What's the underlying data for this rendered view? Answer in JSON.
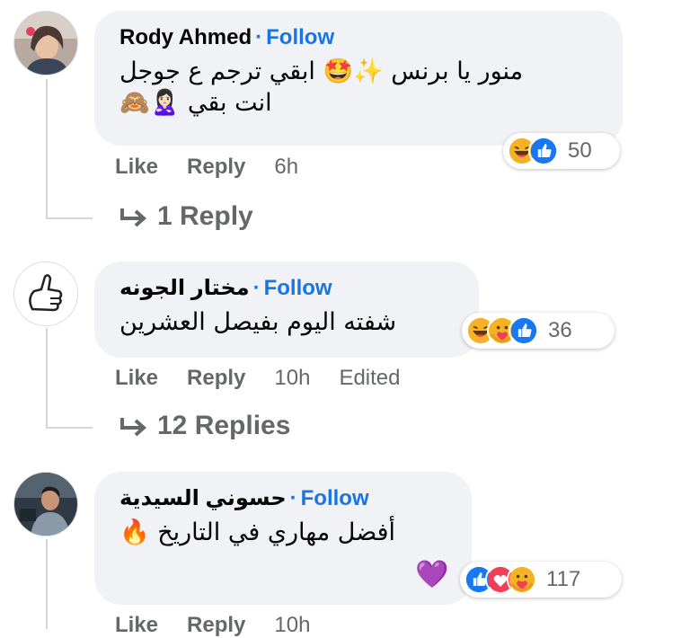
{
  "comments": [
    {
      "author": "Rody Ahmed",
      "follow_label": "Follow",
      "text_line1": "منور يا برنس ✨🤩 ابقي ترجم ع جوجل",
      "text_line2": "انت بقي 🙎🏻‍♀️🙈",
      "reactions": [
        "haha",
        "like"
      ],
      "reaction_count": "50",
      "like_label": "Like",
      "reply_label": "Reply",
      "time": "6h",
      "replies_label": "1 Reply"
    },
    {
      "author": "مختار الجونه",
      "follow_label": "Follow",
      "text_line1": "شفته اليوم بفيصل العشرين",
      "reactions": [
        "haha",
        "care",
        "like"
      ],
      "reaction_count": "36",
      "like_label": "Like",
      "reply_label": "Reply",
      "time": "10h",
      "edited_label": "Edited",
      "replies_label": "12 Replies"
    },
    {
      "author": "حسوني السيدية",
      "follow_label": "Follow",
      "text_line1": "أفضل مهاري في التاريخ 🔥",
      "text_line2": "💜",
      "reactions": [
        "like",
        "love",
        "care"
      ],
      "reaction_count": "117",
      "like_label": "Like",
      "reply_label": "Reply",
      "time": "10h"
    }
  ],
  "colors": {
    "bubble": "#f0f2f5",
    "link": "#1b74e4",
    "secondary_text": "#65676b",
    "thread_line": "#d4d6da"
  }
}
